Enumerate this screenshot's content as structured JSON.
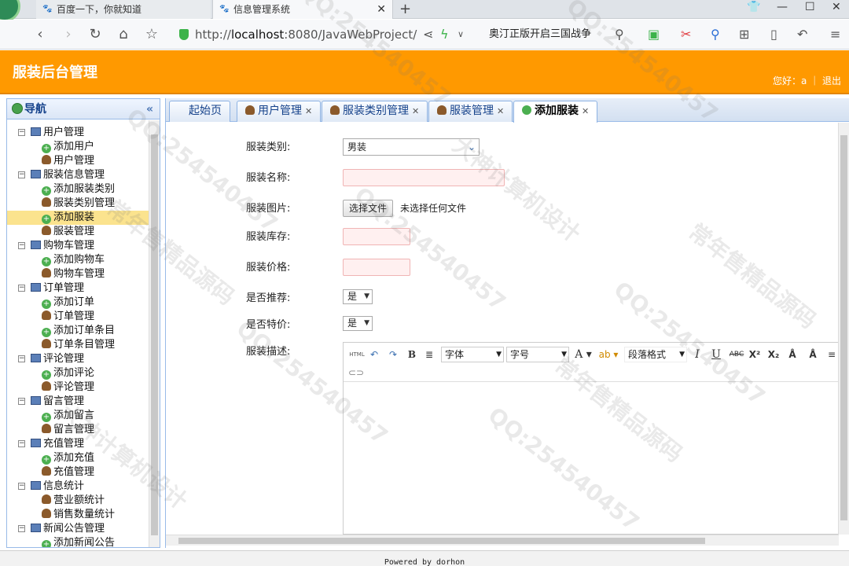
{
  "browser": {
    "tabs": [
      {
        "label": "百度一下，你就知道",
        "active": false
      },
      {
        "label": "信息管理系统",
        "active": true
      }
    ],
    "url_prefix": "http://",
    "url_host": "localhost",
    "url_rest": ":8080/JavaWebProject/",
    "search_text": "奥汀正版开启三国战争"
  },
  "header": {
    "title": "服装后台管理",
    "greeting": "您好：a ｜ 退出"
  },
  "sidebar": {
    "title": "导航",
    "collapse_glyph": "«",
    "groups": [
      {
        "label": "用户管理",
        "items": [
          "添加用户",
          "用户管理"
        ]
      },
      {
        "label": "服装信息管理",
        "items": [
          "添加服装类别",
          "服装类别管理",
          "添加服装",
          "服装管理"
        ]
      },
      {
        "label": "购物车管理",
        "items": [
          "添加购物车",
          "购物车管理"
        ]
      },
      {
        "label": "订单管理",
        "items": [
          "添加订单",
          "订单管理",
          "添加订单条目",
          "订单条目管理"
        ]
      },
      {
        "label": "评论管理",
        "items": [
          "添加评论",
          "评论管理"
        ]
      },
      {
        "label": "留言管理",
        "items": [
          "添加留言",
          "留言管理"
        ]
      },
      {
        "label": "充值管理",
        "items": [
          "添加充值",
          "充值管理"
        ]
      },
      {
        "label": "信息统计",
        "items": [
          "营业额统计",
          "销售数量统计"
        ]
      },
      {
        "label": "新闻公告管理",
        "items": [
          "添加新闻公告"
        ]
      }
    ],
    "selected_item": "添加服装"
  },
  "tabs": [
    {
      "label": "起始页",
      "closable": false
    },
    {
      "label": "用户管理",
      "closable": true
    },
    {
      "label": "服装类别管理",
      "closable": true
    },
    {
      "label": "服装管理",
      "closable": true
    },
    {
      "label": "添加服装",
      "closable": true,
      "active": true
    }
  ],
  "form": {
    "category_label": "服装类别:",
    "category_value": "男装",
    "name_label": "服装名称:",
    "name_value": "",
    "image_label": "服装图片:",
    "file_button": "选择文件",
    "file_status": "未选择任何文件",
    "stock_label": "服装库存:",
    "stock_value": "",
    "price_label": "服装价格:",
    "price_value": "",
    "recommend_label": "是否推荐:",
    "recommend_value": "是",
    "special_label": "是否特价:",
    "special_value": "是",
    "desc_label": "服装描述:"
  },
  "editor": {
    "html_btn": "HTML",
    "font_family": "字体",
    "font_size": "字号",
    "paragraph": "段落格式"
  },
  "footer": {
    "text": "Powered by dorhon"
  },
  "watermark": {
    "qq": "QQ:254540457",
    "a": "大神计算机设计",
    "b": "常年售精品源码"
  }
}
